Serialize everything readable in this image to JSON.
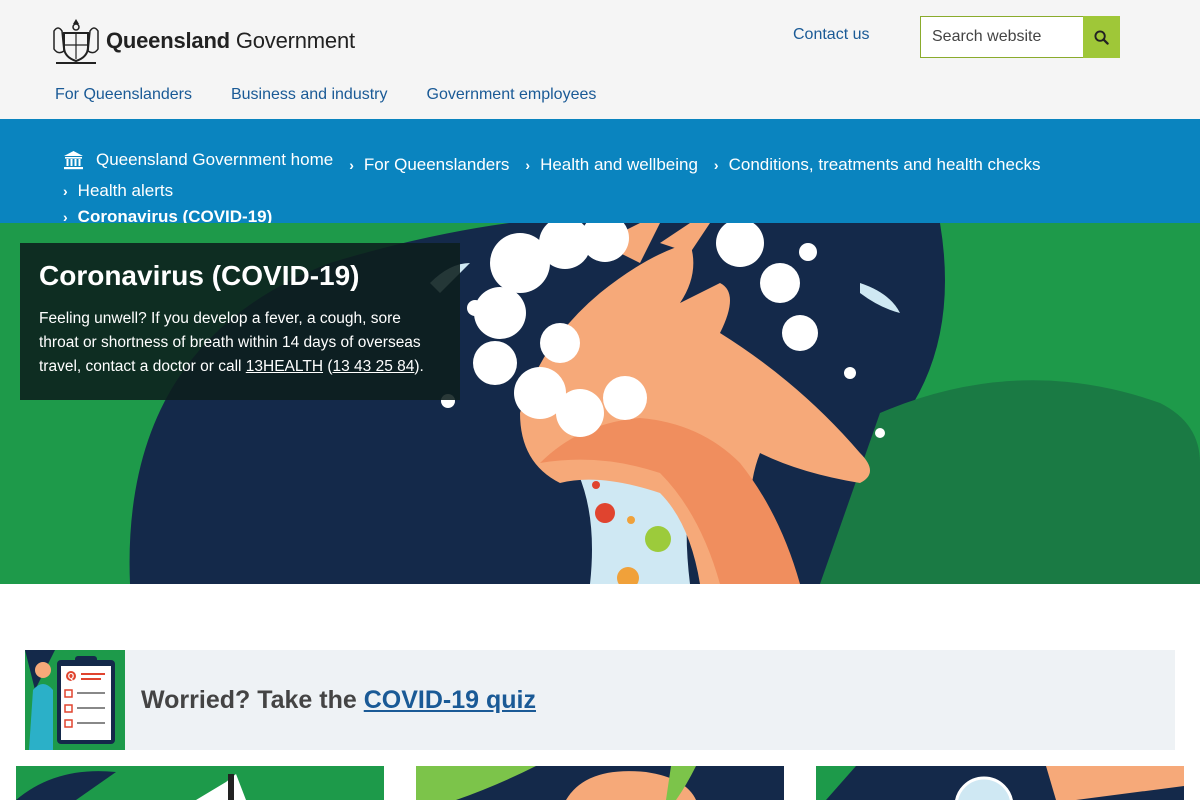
{
  "header": {
    "logo_bold": "Queensland",
    "logo_regular": "Government",
    "contact_label": "Contact us",
    "search_placeholder": "Search website",
    "search_button_icon": "search-icon"
  },
  "nav": {
    "items": [
      {
        "label": "For Queenslanders"
      },
      {
        "label": "Business and industry"
      },
      {
        "label": "Government employees"
      }
    ]
  },
  "breadcrumb": {
    "items": [
      {
        "label": "Queensland Government home",
        "icon": "home-icon"
      },
      {
        "label": "For Queenslanders"
      },
      {
        "label": "Health and wellbeing"
      },
      {
        "label": "Conditions, treatments and health checks"
      },
      {
        "label": "Health alerts"
      },
      {
        "label": "Coronavirus (COVID-19)"
      }
    ]
  },
  "hero": {
    "title": "Coronavirus (COVID-19)",
    "text_before": "Feeling unwell? If you develop a fever, a cough, sore throat or shortness of breath within 14 days of overseas travel, contact a doctor or call ",
    "link1": "13HEALTH",
    "text_mid": " (",
    "link2": "13 43 25 84",
    "text_after": ")."
  },
  "quiz": {
    "prefix": "Worried? Take the ",
    "link": "COVID-19 quiz"
  },
  "colors": {
    "brand_blue": "#0a84bf",
    "link_blue": "#1a5a96",
    "accent_green": "#9fc738",
    "hero_green": "#1e9a4a",
    "navy": "#14294a"
  }
}
